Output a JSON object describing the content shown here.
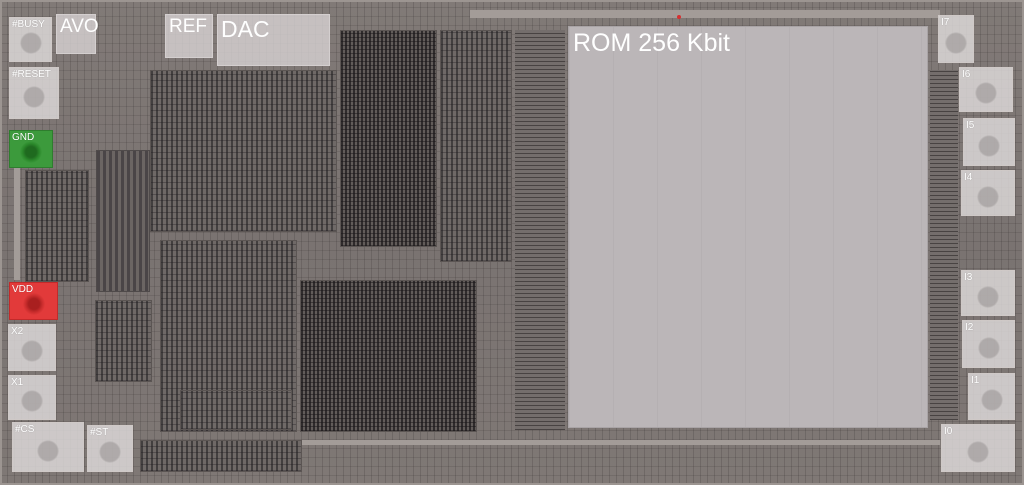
{
  "blocks": {
    "avo": "AVO",
    "ref": "REF",
    "dac": "DAC",
    "rom": "ROM 256 Kbit"
  },
  "pads": {
    "busy": "#BUSY",
    "reset": "#RESET",
    "gnd": "GND",
    "vdd": "VDD",
    "x2": "X2",
    "x1": "X1",
    "cs": "#CS",
    "st": "#ST",
    "i7": "I7",
    "i6": "I6",
    "i5": "I5",
    "i4": "I4",
    "i3": "I3",
    "i2": "I2",
    "i1": "I1",
    "i0": "I0"
  },
  "colors": {
    "gnd_pad": "#3c9a3c",
    "vdd_pad": "#e23a3a",
    "label": "#ffffff",
    "rom_overlay": "#bbb6b8"
  }
}
